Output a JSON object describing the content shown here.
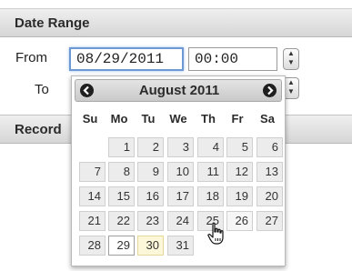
{
  "panel": {
    "date_range_title": "Date Range",
    "record_title": "Record",
    "from_label": "From",
    "to_label": "To",
    "from_date": "08/29/2011",
    "from_time": "00:00"
  },
  "calendar": {
    "month_title": "August 2011",
    "weekdays": [
      "Su",
      "Mo",
      "Tu",
      "We",
      "Th",
      "Fr",
      "Sa"
    ],
    "weeks": [
      [
        "",
        "1",
        "2",
        "3",
        "4",
        "5",
        "6"
      ],
      [
        "7",
        "8",
        "9",
        "10",
        "11",
        "12",
        "13"
      ],
      [
        "14",
        "15",
        "16",
        "17",
        "18",
        "19",
        "20"
      ],
      [
        "21",
        "22",
        "23",
        "24",
        "25",
        "26",
        "27"
      ],
      [
        "28",
        "29",
        "30",
        "31",
        "",
        "",
        ""
      ]
    ],
    "selected_day": "29",
    "highlighted_day": "30",
    "hovered_day": "26"
  },
  "colors": {
    "focus_border": "#6c98d4",
    "cell_bg": "#ececec",
    "highlight_bg": "#fdf7d9"
  },
  "icons": {
    "prev": "circle-left-arrow-icon",
    "next": "circle-right-arrow-icon",
    "stepper": "up-down-stepper-icon",
    "pointer": "hand-pointer-icon"
  }
}
